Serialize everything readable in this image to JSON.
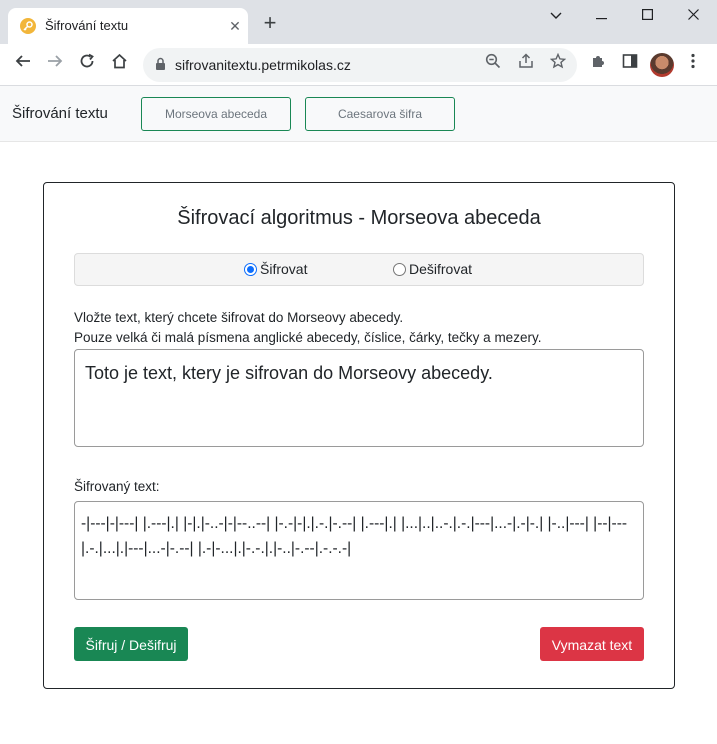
{
  "browser": {
    "tab_title": "Šifrování textu",
    "tab_close": "✕",
    "new_tab": "+",
    "url": "sifrovanitextu.petrmikolas.cz",
    "window_minimize": "⌄",
    "window_min": "—",
    "window_max": "☐",
    "window_close": "✕"
  },
  "navbar": {
    "brand": "Šifrování textu",
    "links": [
      {
        "label": "Morseova abeceda"
      },
      {
        "label": "Caesarova šifra"
      }
    ]
  },
  "card": {
    "title": "Šifrovací algoritmus - Morseova abeceda",
    "mode": {
      "options": [
        {
          "label": "Šifrovat",
          "checked": true
        },
        {
          "label": "Dešifrovat",
          "checked": false
        }
      ]
    },
    "input_help_line1": "Vložte text, který chcete šifrovat do Morseovy abecedy.",
    "input_help_line2": "Pouze velká či malá písmena anglické abecedy, číslice, čárky, tečky a mezery.",
    "input_value": "Toto je text, ktery je sifrovan do Morseovy abecedy.",
    "output_label": "Šifrovaný text:",
    "output_value": "-|---|-|---| |.---|.| |-|.|-..-|-|--..--| |-.-|-|.|.-.|-.--| |.---|.| |...|..|..-.|.-.|---|...-|.-|-.| |-..|---| |--|---|.-.|...|.|---|...-|-.--| |.-|-...|.|-.-.|.|-..|-.--|.-.-.-|",
    "encrypt_button": "Šifruj / Dešifruj",
    "clear_button": "Vymazat text"
  },
  "colors": {
    "success": "#198754",
    "danger": "#dc3545",
    "primary": "#0d6efd"
  }
}
